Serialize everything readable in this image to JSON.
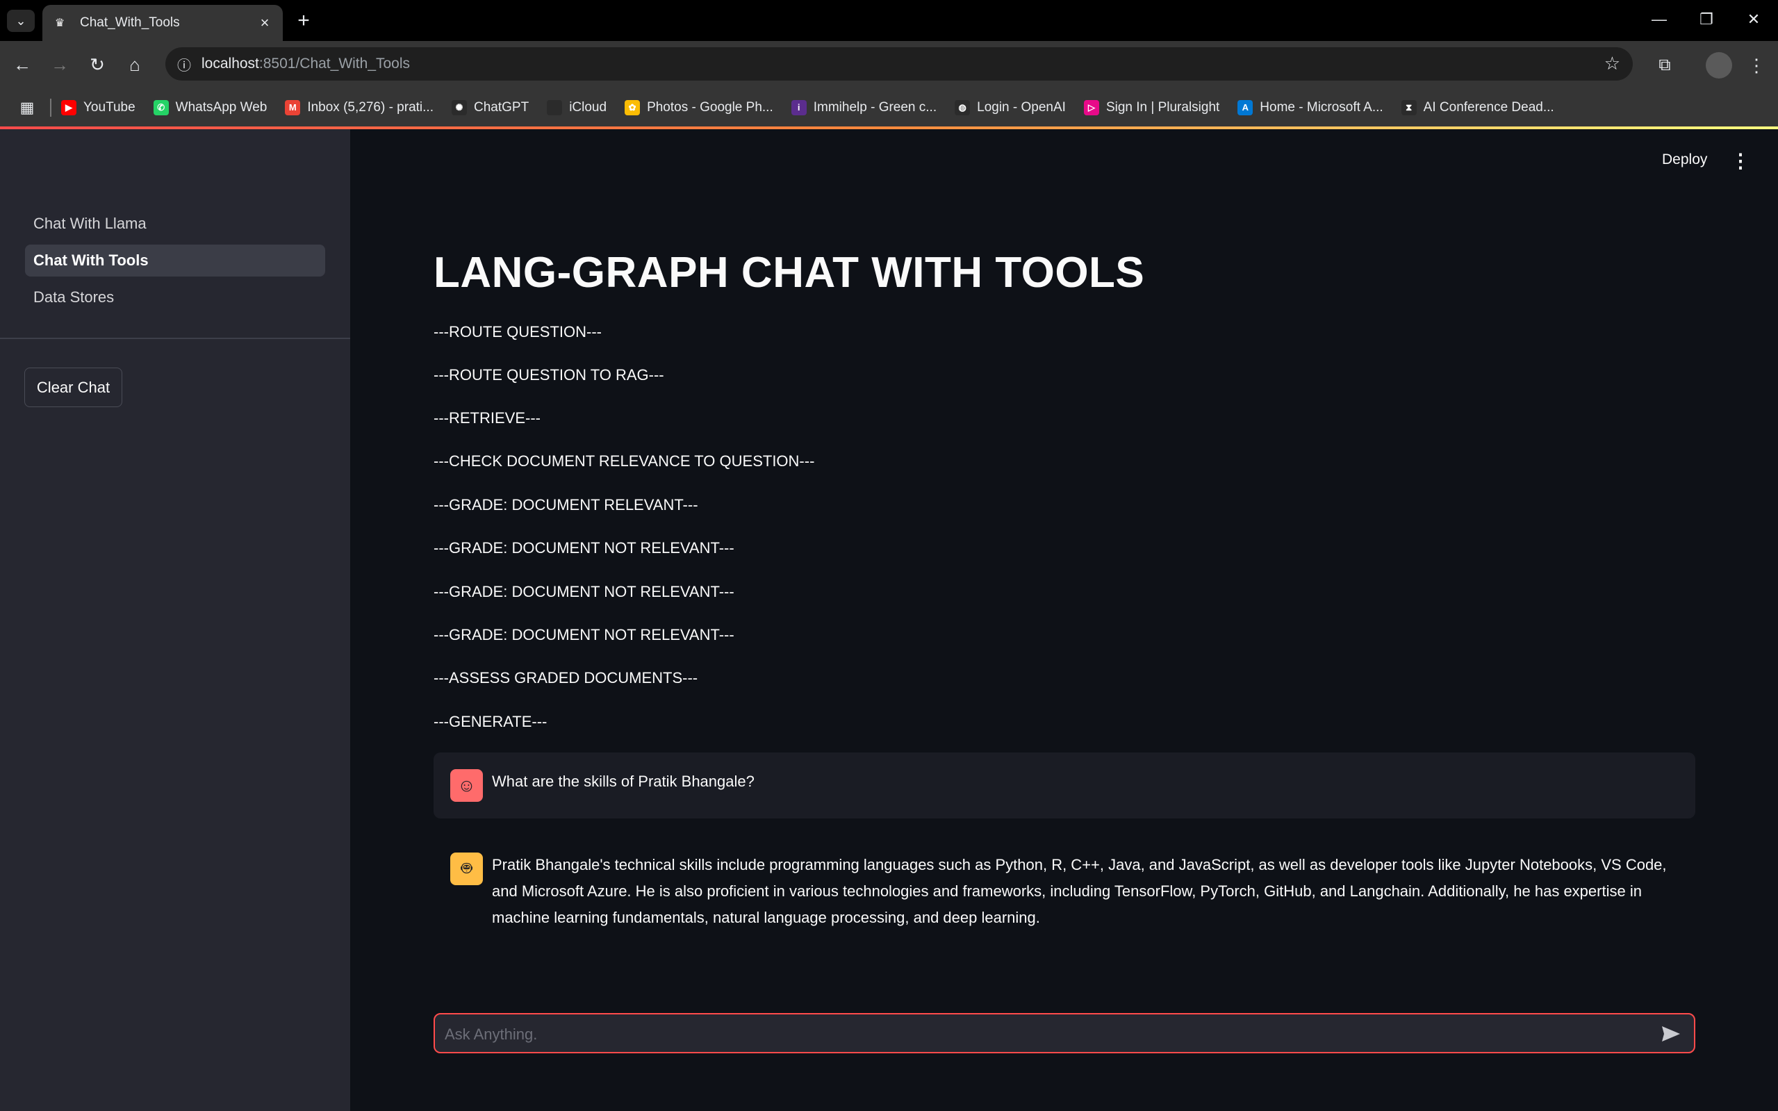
{
  "browser": {
    "tab_title": "Chat_With_Tools",
    "url_host": "localhost",
    "url_rest": ":8501/Chat_With_Tools",
    "bookmarks": [
      {
        "label": "YouTube",
        "icon": "youtube-icon",
        "color": "#ff0000",
        "glyph": "▶"
      },
      {
        "label": "WhatsApp Web",
        "icon": "whatsapp-icon",
        "color": "#25d366",
        "glyph": "✆"
      },
      {
        "label": "Inbox (5,276) - prati...",
        "icon": "gmail-icon",
        "color": "#ea4335",
        "glyph": "M"
      },
      {
        "label": "ChatGPT",
        "icon": "chatgpt-icon",
        "color": "#2b2b2b",
        "glyph": "✺"
      },
      {
        "label": "iCloud",
        "icon": "apple-icon",
        "color": "#2b2b2b",
        "glyph": ""
      },
      {
        "label": "Photos - Google Ph...",
        "icon": "google-photos-icon",
        "color": "#fbbc04",
        "glyph": "✿"
      },
      {
        "label": "Immihelp - Green c...",
        "icon": "immihelp-icon",
        "color": "#5b2d8e",
        "glyph": "i"
      },
      {
        "label": "Login - OpenAI",
        "icon": "globe-icon",
        "color": "#2b2b2b",
        "glyph": "◍"
      },
      {
        "label": "Sign In | Pluralsight",
        "icon": "pluralsight-icon",
        "color": "#e80a89",
        "glyph": "▷"
      },
      {
        "label": "Home - Microsoft A...",
        "icon": "azure-icon",
        "color": "#0078d4",
        "glyph": "A"
      },
      {
        "label": "AI Conference Dead...",
        "icon": "hourglass-icon",
        "color": "#2b2b2b",
        "glyph": "⧗"
      }
    ]
  },
  "sidebar": {
    "nav": [
      {
        "label": "Chat With Llama",
        "active": false
      },
      {
        "label": "Chat With Tools",
        "active": true
      },
      {
        "label": "Data Stores",
        "active": false
      }
    ],
    "clear_button": "Clear Chat"
  },
  "header": {
    "deploy_label": "Deploy"
  },
  "main": {
    "title": "LANG-GRAPH CHAT WITH TOOLS",
    "log_lines": [
      "---ROUTE QUESTION---",
      "---ROUTE QUESTION TO RAG---",
      "---RETRIEVE---",
      "---CHECK DOCUMENT RELEVANCE TO QUESTION---",
      "---GRADE: DOCUMENT RELEVANT---",
      "---GRADE: DOCUMENT NOT RELEVANT---",
      "---GRADE: DOCUMENT NOT RELEVANT---",
      "---GRADE: DOCUMENT NOT RELEVANT---",
      "---ASSESS GRADED DOCUMENTS---",
      "---GENERATE---"
    ],
    "messages": [
      {
        "role": "user",
        "text": "What are the skills of Pratik Bhangale?"
      },
      {
        "role": "assistant",
        "lines": [
          "Pratik Bhangale's technical skills include programming languages such as Python, R, C++, Java, and JavaScript, as well as developer tools like Jupyter Notebooks, VS Code,",
          "and Microsoft Azure. He is also proficient in various technologies and frameworks, including TensorFlow, PyTorch, GitHub, and Langchain. Additionally, he has expertise in",
          "machine learning fundamentals, natural language processing, and deep learning."
        ]
      }
    ],
    "chat_input": {
      "placeholder": "Ask Anything.",
      "value": ""
    }
  },
  "colors": {
    "app_bg": "#0e1117",
    "sidebar_bg": "#262730",
    "accent": "#ff4b4b",
    "user_avatar": "#ff6b6b",
    "assistant_avatar": "#ffbd45"
  }
}
